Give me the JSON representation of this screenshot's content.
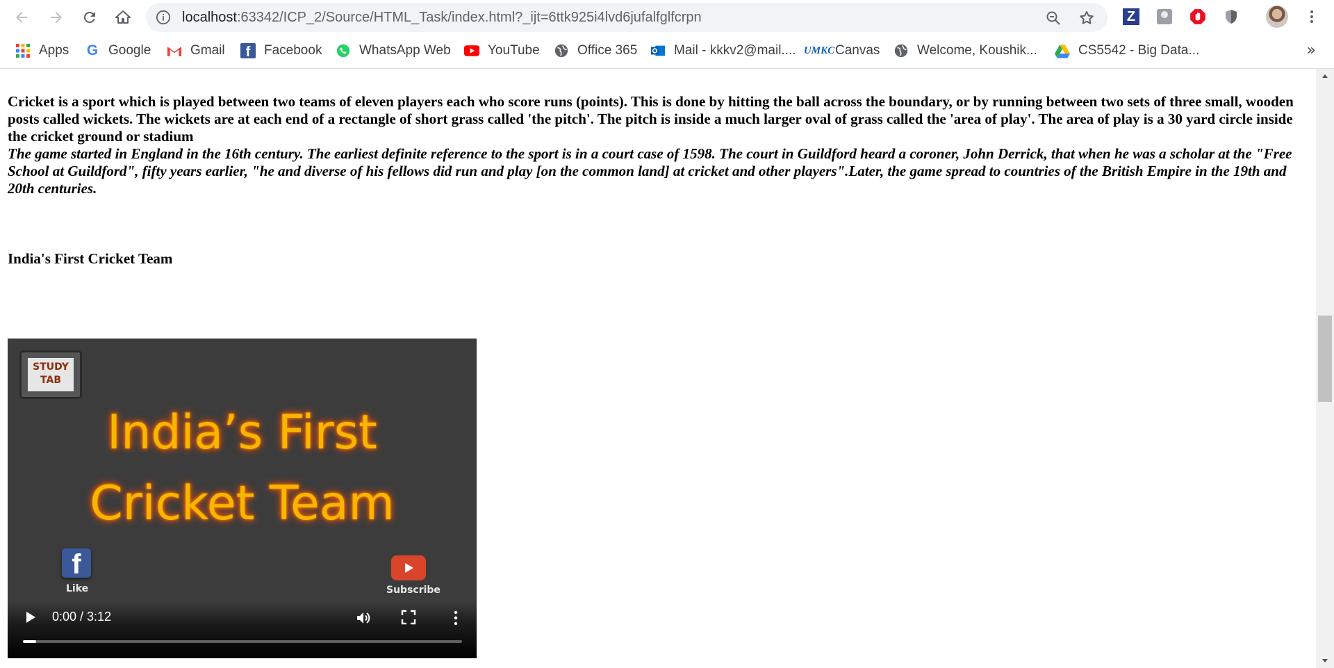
{
  "browser": {
    "url_host": "localhost",
    "url_path": ":63342/ICP_2/Source/HTML_Task/index.html?_ijt=6ttk925i4lvd6jufalfglfcrpn",
    "back_icon": "arrow-left-icon",
    "forward_icon": "arrow-right-icon",
    "reload_icon": "reload-icon",
    "home_icon": "home-icon"
  },
  "bookmarks": [
    {
      "label": "Apps",
      "icon": "apps-grid-icon"
    },
    {
      "label": "Google",
      "icon": "google-icon"
    },
    {
      "label": "Gmail",
      "icon": "gmail-icon"
    },
    {
      "label": "Facebook",
      "icon": "facebook-icon"
    },
    {
      "label": "WhatsApp Web",
      "icon": "whatsapp-icon"
    },
    {
      "label": "YouTube",
      "icon": "youtube-icon"
    },
    {
      "label": "Office 365",
      "icon": "globe-icon"
    },
    {
      "label": "Mail - kkkv2@mail....",
      "icon": "outlook-icon"
    },
    {
      "label": "Canvas",
      "icon": "umkc-icon"
    },
    {
      "label": "Welcome, Koushik...",
      "icon": "globe-icon"
    },
    {
      "label": "CS5542 - Big Data...",
      "icon": "google-drive-icon"
    }
  ],
  "bookmarks_more": "»",
  "page": {
    "paragraph1": "Cricket is a sport which is played between two teams of eleven players each who score runs (points). This is done by hitting the ball across the boundary, or by running between two sets of three small, wooden posts called wickets. The wickets are at each end of a rectangle of short grass called 'the pitch'. The pitch is inside a much larger oval of grass called the 'area of play'. The area of play is a 30 yard circle inside the cricket ground or stadium",
    "paragraph2": "The game started in England in the 16th century. The earliest definite reference to the sport is in a court case of 1598. The court in Guildford heard a coroner, John Derrick, that when he was a scholar at the \"Free School at Guildford\", fifty years earlier, \"he and diverse of his fellows did run and play [on the common land] at cricket and other players\".Later, the game spread to countries of the British Empire in the 19th and 20th centuries.",
    "heading": "India's First Cricket Team"
  },
  "video": {
    "badge_line1": "STUDY",
    "badge_line2": "TAB",
    "title_line1": "India’s First",
    "title_line2": "Cricket Team",
    "fb_label": "Like",
    "yt_label": "Subscribe",
    "time": "0:00 / 3:12",
    "progress": 0.03,
    "title_color": "#f5b800"
  },
  "scrollbar": {
    "thumb_position": 0.48,
    "thumb_fraction": 0.15
  }
}
